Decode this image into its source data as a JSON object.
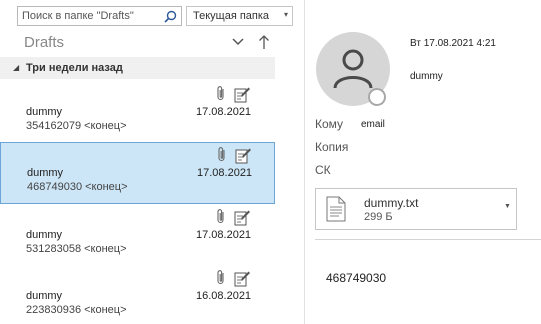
{
  "search": {
    "placeholder": "Поиск в папке \"Drafts\"",
    "scope": "Текущая папка"
  },
  "folder": {
    "title": "Drafts"
  },
  "group": {
    "label": "Три недели назад"
  },
  "messages": [
    {
      "sender": "dummy",
      "date": "17.08.2021",
      "preview": "354162079 <конец>",
      "selected": false
    },
    {
      "sender": "dummy",
      "date": "17.08.2021",
      "preview": "468749030 <конец>",
      "selected": true
    },
    {
      "sender": "dummy",
      "date": "17.08.2021",
      "preview": "531283058 <конец>",
      "selected": false
    },
    {
      "sender": "dummy",
      "date": "16.08.2021",
      "preview": "223830936 <конец>",
      "selected": false
    }
  ],
  "reading": {
    "sent": "Вт 17.08.2021 4:21",
    "from": "dummy",
    "to_label": "Кому",
    "to_value": "email",
    "cc_label": "Копия",
    "bcc_label": "СК",
    "attachment": {
      "name": "dummy.txt",
      "size": "299 Б"
    },
    "body": "468749030"
  },
  "colors": {
    "selection": "#cde6f7",
    "selection_border": "#6ca6d9",
    "group_header": "#f0f0f0"
  }
}
